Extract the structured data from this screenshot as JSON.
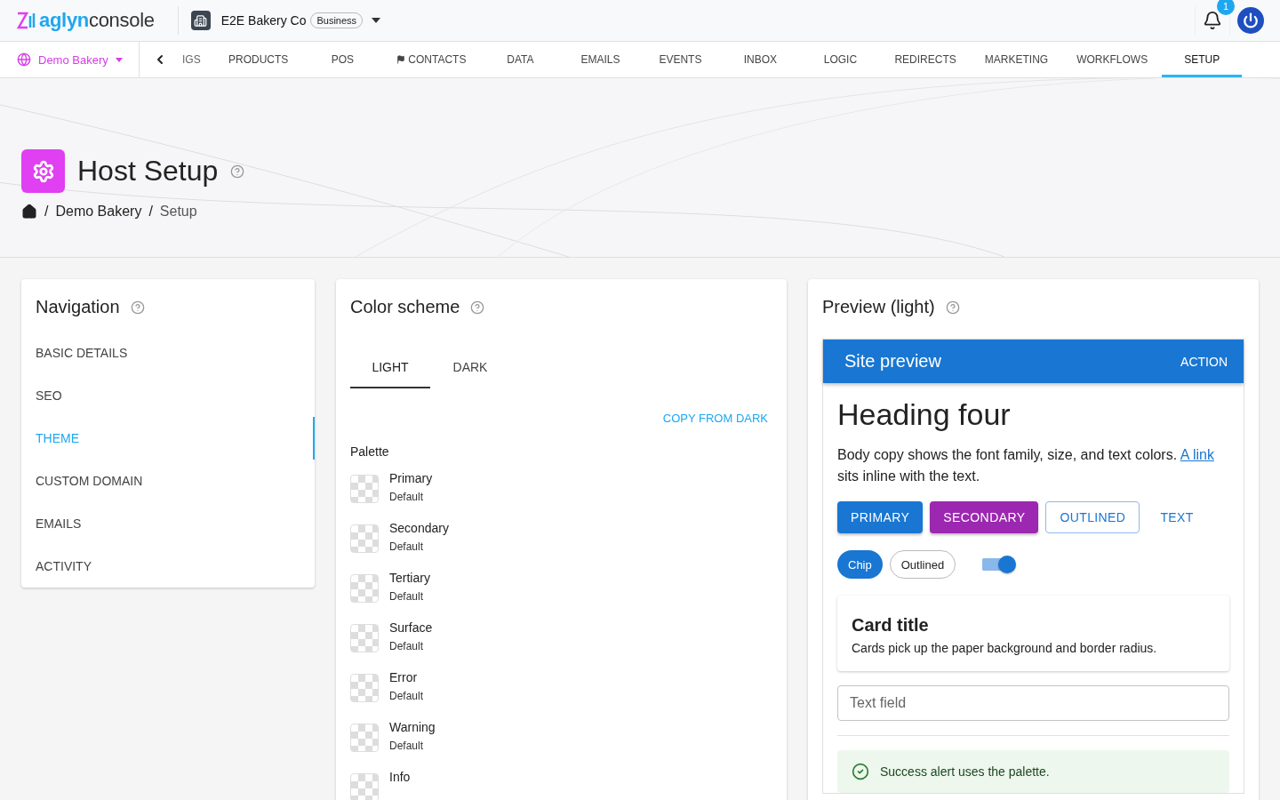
{
  "top_bar": {
    "logo": {
      "brand": "aglyn",
      "product": "console"
    },
    "organization": {
      "name": "E2E Bakery Co",
      "badge": "Business"
    },
    "notifications": {
      "count": "1"
    }
  },
  "nav_bar": {
    "site": {
      "label": "Demo Bakery"
    },
    "tabs": [
      {
        "label": "IGS",
        "selected": false,
        "kind": "text"
      },
      {
        "label": "PRODUCTS",
        "selected": false,
        "kind": "text"
      },
      {
        "label": "POS",
        "selected": false,
        "kind": "text"
      },
      {
        "label": "CONTACTS",
        "selected": false,
        "kind": "flag"
      },
      {
        "label": "DATA",
        "selected": false,
        "kind": "text"
      },
      {
        "label": "EMAILS",
        "selected": false,
        "kind": "text"
      },
      {
        "label": "EVENTS",
        "selected": false,
        "kind": "text"
      },
      {
        "label": "INBOX",
        "selected": false,
        "kind": "text"
      },
      {
        "label": "LOGIC",
        "selected": false,
        "kind": "text"
      },
      {
        "label": "REDIRECTS",
        "selected": false,
        "kind": "text"
      },
      {
        "label": "MARKETING",
        "selected": false,
        "kind": "text"
      },
      {
        "label": "WORKFLOWS",
        "selected": false,
        "kind": "text"
      },
      {
        "label": "SETUP",
        "selected": true,
        "kind": "text"
      }
    ]
  },
  "page_header": {
    "title": "Host Setup",
    "breadcrumb": [
      "Demo Bakery",
      "Setup"
    ],
    "breadcrumb_separator": "/"
  },
  "navigation": {
    "title": "Navigation",
    "items": [
      {
        "label": "BASIC DETAILS",
        "selected": false
      },
      {
        "label": "SEO",
        "selected": false
      },
      {
        "label": "THEME",
        "selected": true
      },
      {
        "label": "CUSTOM DOMAIN",
        "selected": false
      },
      {
        "label": "EMAILS",
        "selected": false
      },
      {
        "label": "ACTIVITY",
        "selected": false
      }
    ]
  },
  "color_scheme": {
    "title": "Color scheme",
    "tabs": [
      {
        "label": "LIGHT",
        "selected": true
      },
      {
        "label": "DARK",
        "selected": false
      }
    ],
    "copy_button": "COPY FROM DARK",
    "palette_label": "Palette",
    "palette": [
      {
        "name": "Primary",
        "value": "Default"
      },
      {
        "name": "Secondary",
        "value": "Default"
      },
      {
        "name": "Tertiary",
        "value": "Default"
      },
      {
        "name": "Surface",
        "value": "Default"
      },
      {
        "name": "Error",
        "value": "Default"
      },
      {
        "name": "Warning",
        "value": "Default"
      },
      {
        "name": "Info"
      }
    ]
  },
  "preview": {
    "title": "Preview (light)",
    "app_bar": {
      "title": "Site preview",
      "action": "ACTION"
    },
    "heading": "Heading four",
    "body": "Body copy shows the font family, size, and text colors.",
    "link": "A link",
    "body_end": "sits inline with the text.",
    "buttons": [
      {
        "label": "PRIMARY",
        "kind": "primary"
      },
      {
        "label": "SECONDARY",
        "kind": "secondary"
      },
      {
        "label": "OUTLINED",
        "kind": "outlined"
      },
      {
        "label": "TEXT",
        "kind": "text"
      }
    ],
    "chips": [
      {
        "label": "Chip",
        "kind": "filled"
      },
      {
        "label": "Outlined",
        "kind": "outlined"
      }
    ],
    "switch": {
      "on": true
    },
    "card": {
      "title": "Card title",
      "text": "Cards pick up the paper background and border radius."
    },
    "text_field": {
      "placeholder": "Text field"
    },
    "alert": {
      "text": "Success alert uses the palette."
    }
  }
}
